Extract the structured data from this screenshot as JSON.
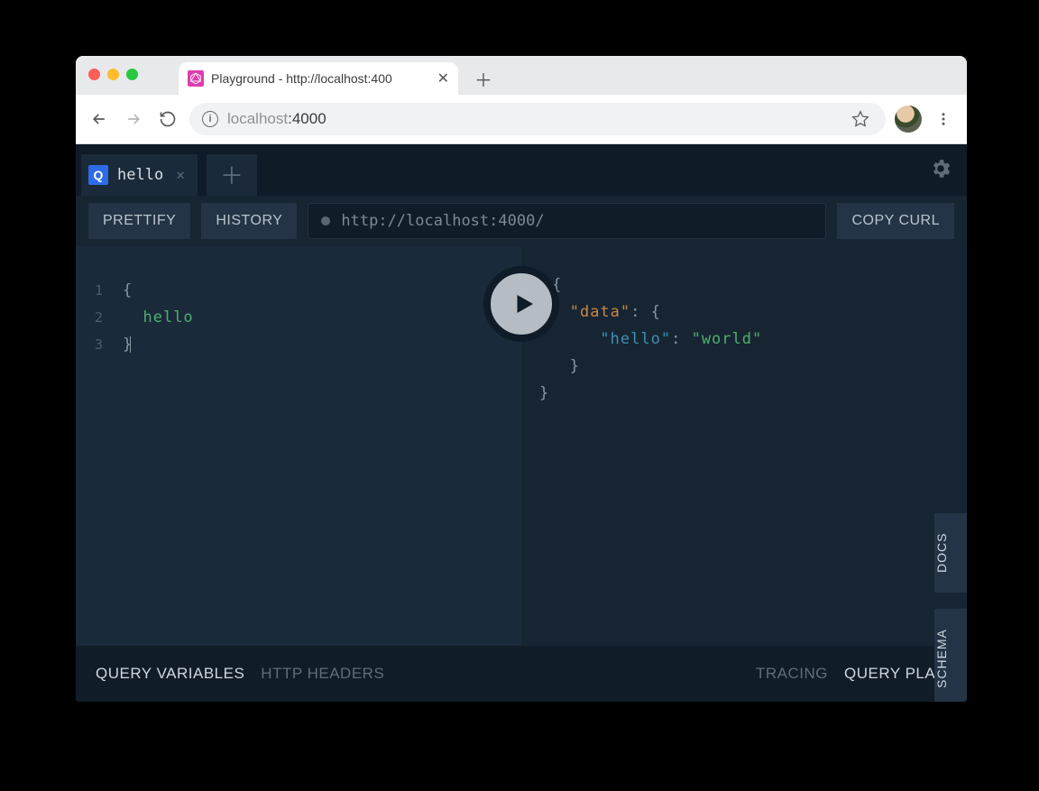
{
  "browser": {
    "tab_title": "Playground - http://localhost:400",
    "url_host": "localhost",
    "url_port": ":4000"
  },
  "app": {
    "tab": {
      "badge": "Q",
      "title": "hello"
    },
    "buttons": {
      "prettify": "PRETTIFY",
      "history": "HISTORY",
      "copy_curl": "COPY CURL"
    },
    "endpoint": "http://localhost:4000/",
    "query": {
      "lines": [
        "1",
        "2",
        "3"
      ],
      "open_brace": "{",
      "field": "hello",
      "close_brace": "}"
    },
    "result": {
      "open": "{",
      "data_key": "\"data\"",
      "hello_key": "\"hello\"",
      "hello_val": "\"world\"",
      "colon": ":",
      "inner_open": "{",
      "inner_close": "}",
      "close": "}"
    },
    "side": {
      "docs": "DOCS",
      "schema": "SCHEMA"
    },
    "footer": {
      "query_vars": "QUERY VARIABLES",
      "http_headers": "HTTP HEADERS",
      "tracing": "TRACING",
      "query_plan": "QUERY PLAN"
    }
  }
}
